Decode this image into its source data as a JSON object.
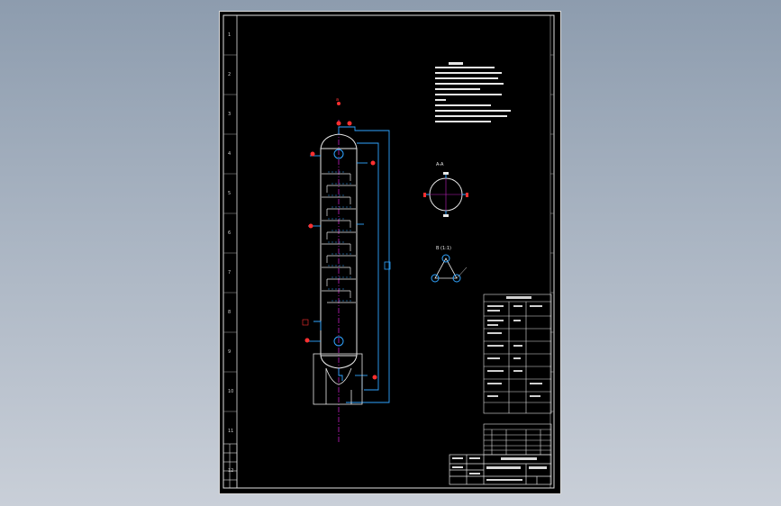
{
  "sheet": {
    "border_color": "#e0e0e0",
    "background": "#000000",
    "side_ticks": [
      "1",
      "2",
      "3",
      "4",
      "5",
      "6",
      "7",
      "8",
      "9",
      "10",
      "11",
      "12"
    ]
  },
  "colors": {
    "vessel": "#e8e8e8",
    "piping": "#2fa4ff",
    "nozzle_labels": "#ff3030",
    "centerline": "#c020c0",
    "trays": "#e8e8e8"
  },
  "annotations": {
    "top_nozzle_tag": "a",
    "section_label": "A-A",
    "orientation_label": "B (1:1)"
  }
}
